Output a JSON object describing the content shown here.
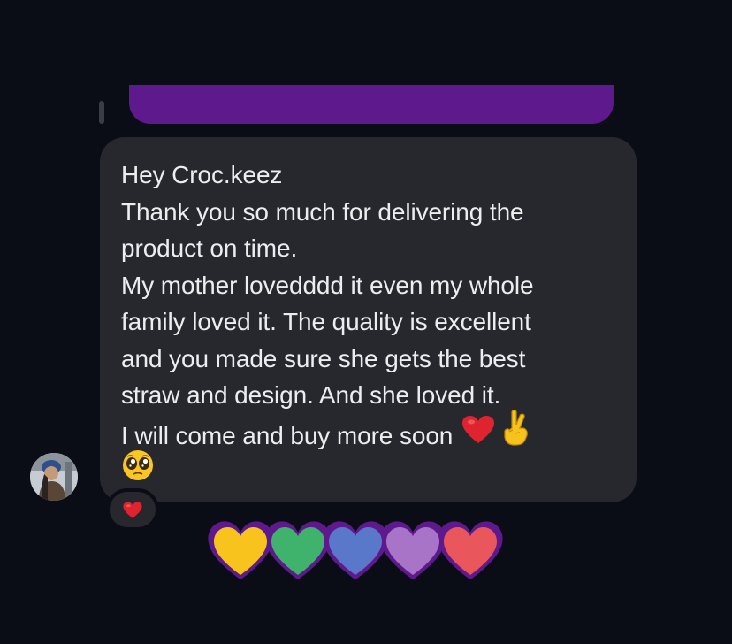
{
  "sent_message": {
    "bubble_color": "#5e1a8c"
  },
  "received_message": {
    "lines": [
      "Hey Croc.keez",
      "Thank you so much for delivering the",
      "product on time.",
      "My mother lovedddd it even my whole",
      "family loved it. The quality is excellent",
      "and you made sure she gets the best",
      "straw and design. And she loved it.",
      "I will come and buy more soon"
    ],
    "trailing_emojis": [
      "red-heart-icon",
      "crossed-fingers-icon"
    ],
    "extra_emoji": "pleading-face-icon",
    "bubble_color": "#26282e",
    "text_color": "#ecedef"
  },
  "reaction": {
    "icon": "red-heart-icon"
  },
  "sticker": {
    "icon": "rainbow-hearts-sticker",
    "heart_colors": [
      "#f7c31c",
      "#3fb36b",
      "#5a78c9",
      "#a774c7",
      "#e9575c"
    ],
    "outline_color": "#5e1a8c"
  },
  "background_color": "#0a0d15"
}
